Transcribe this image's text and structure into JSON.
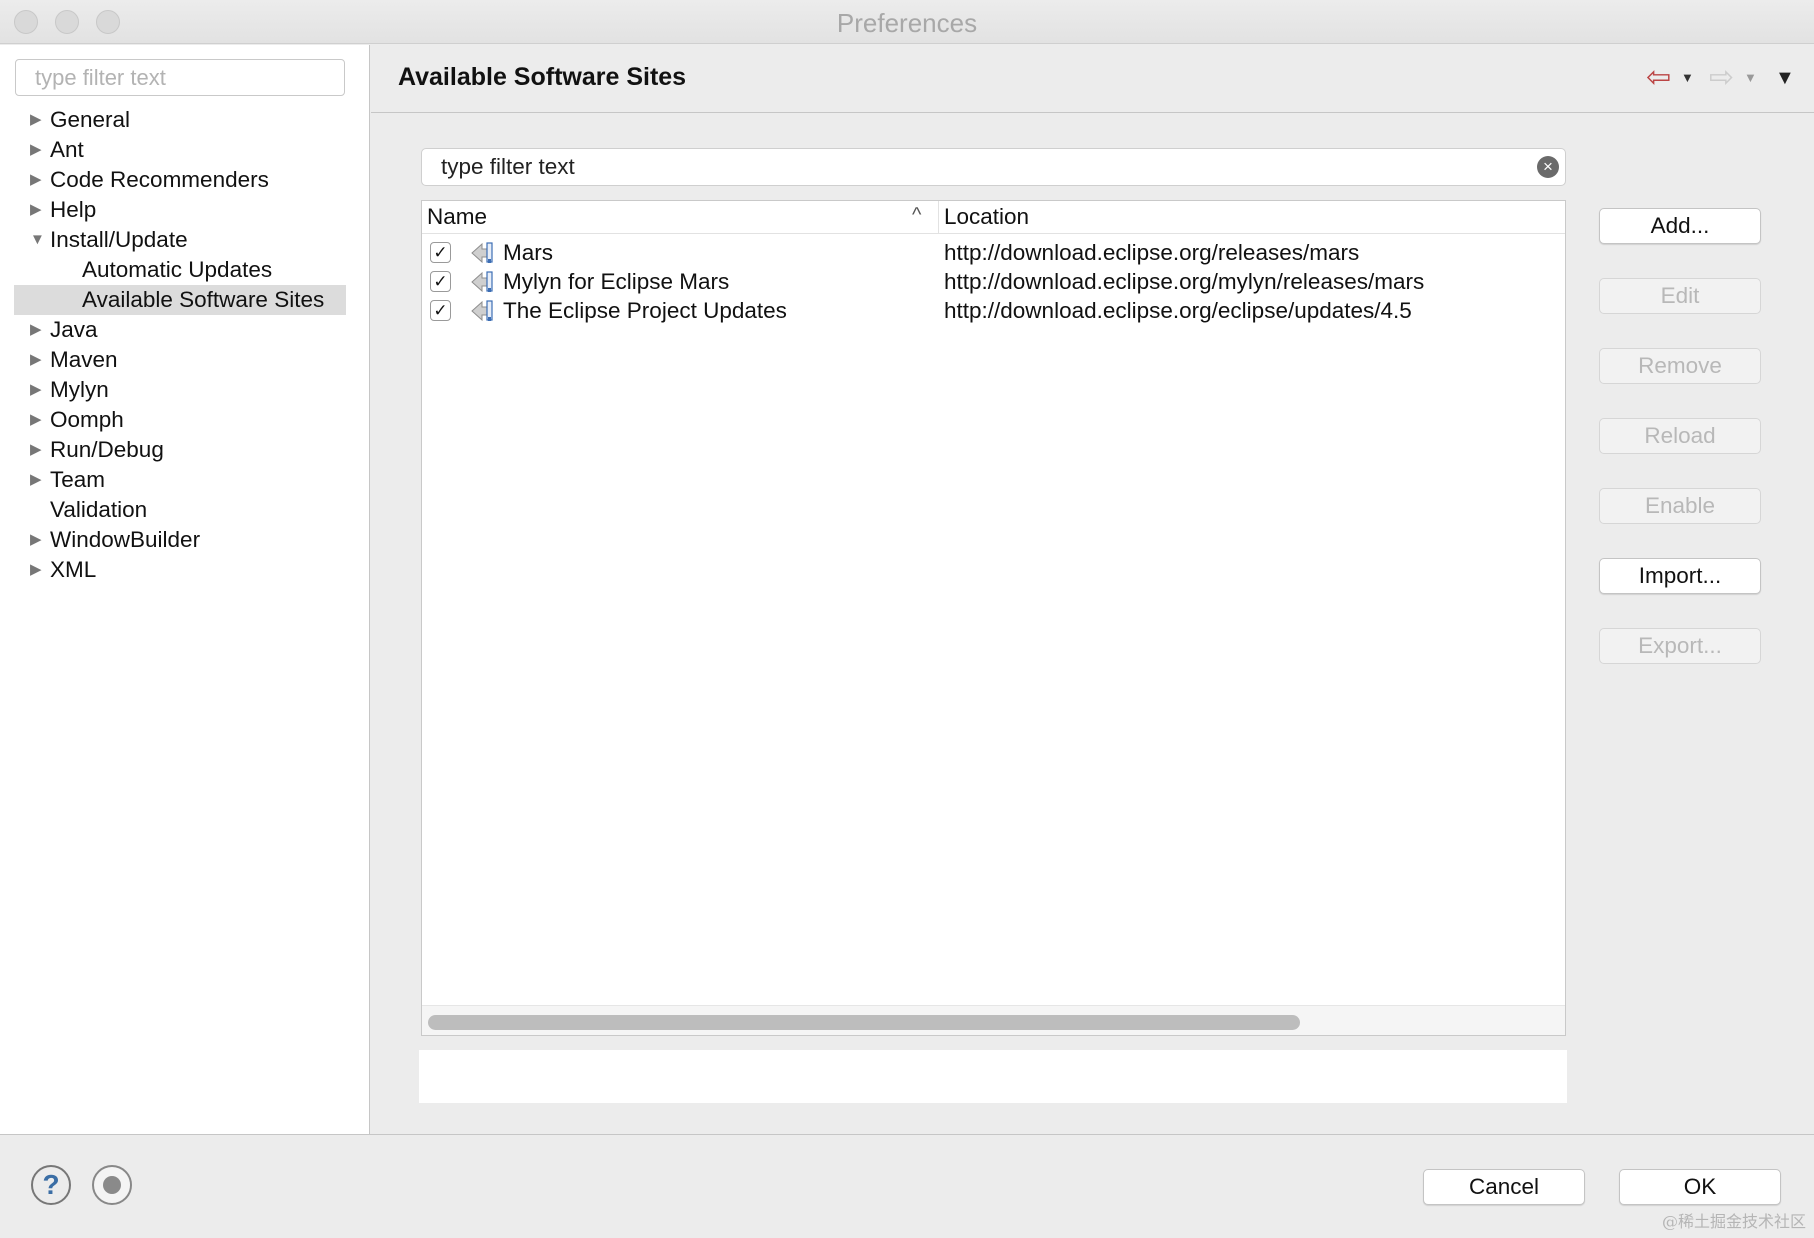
{
  "window": {
    "title": "Preferences"
  },
  "sidebar": {
    "filter_placeholder": "type filter text",
    "items": [
      {
        "label": "General",
        "expandable": true
      },
      {
        "label": "Ant",
        "expandable": true
      },
      {
        "label": "Code Recommenders",
        "expandable": true
      },
      {
        "label": "Help",
        "expandable": true
      },
      {
        "label": "Install/Update",
        "expandable": true,
        "expanded": true
      },
      {
        "label": "Automatic Updates",
        "child": true
      },
      {
        "label": "Available Software Sites",
        "child": true,
        "selected": true
      },
      {
        "label": "Java",
        "expandable": true
      },
      {
        "label": "Maven",
        "expandable": true
      },
      {
        "label": "Mylyn",
        "expandable": true
      },
      {
        "label": "Oomph",
        "expandable": true
      },
      {
        "label": "Run/Debug",
        "expandable": true
      },
      {
        "label": "Team",
        "expandable": true
      },
      {
        "label": "Validation",
        "expandable": false
      },
      {
        "label": "WindowBuilder",
        "expandable": true
      },
      {
        "label": "XML",
        "expandable": true
      }
    ]
  },
  "page": {
    "title": "Available Software Sites",
    "filter_value": "type filter text"
  },
  "table": {
    "columns": {
      "name": "Name",
      "location": "Location"
    },
    "sort_indicator": "^",
    "rows": [
      {
        "checked": true,
        "name": "Mars",
        "location": "http://download.eclipse.org/releases/mars"
      },
      {
        "checked": true,
        "name": "Mylyn for Eclipse Mars",
        "location": "http://download.eclipse.org/mylyn/releases/mars"
      },
      {
        "checked": true,
        "name": "The Eclipse Project Updates",
        "location": "http://download.eclipse.org/eclipse/updates/4.5"
      }
    ]
  },
  "buttons": {
    "add": "Add...",
    "edit": "Edit",
    "remove": "Remove",
    "reload": "Reload",
    "enable": "Enable",
    "import": "Import...",
    "export": "Export..."
  },
  "footer": {
    "cancel": "Cancel",
    "ok": "OK",
    "help_glyph": "?"
  },
  "watermark": "@稀土掘金技术社区",
  "icons": {
    "back": "back-arrow-icon",
    "forward": "forward-arrow-icon",
    "view_menu": "view-menu-icon",
    "clear": "clear-icon",
    "site": "update-site-icon",
    "help": "help-icon",
    "record": "record-macro-icon"
  },
  "colors": {
    "selection": "#dcdcdc",
    "background": "#ececec",
    "disabled_text": "#b8b8b8"
  }
}
